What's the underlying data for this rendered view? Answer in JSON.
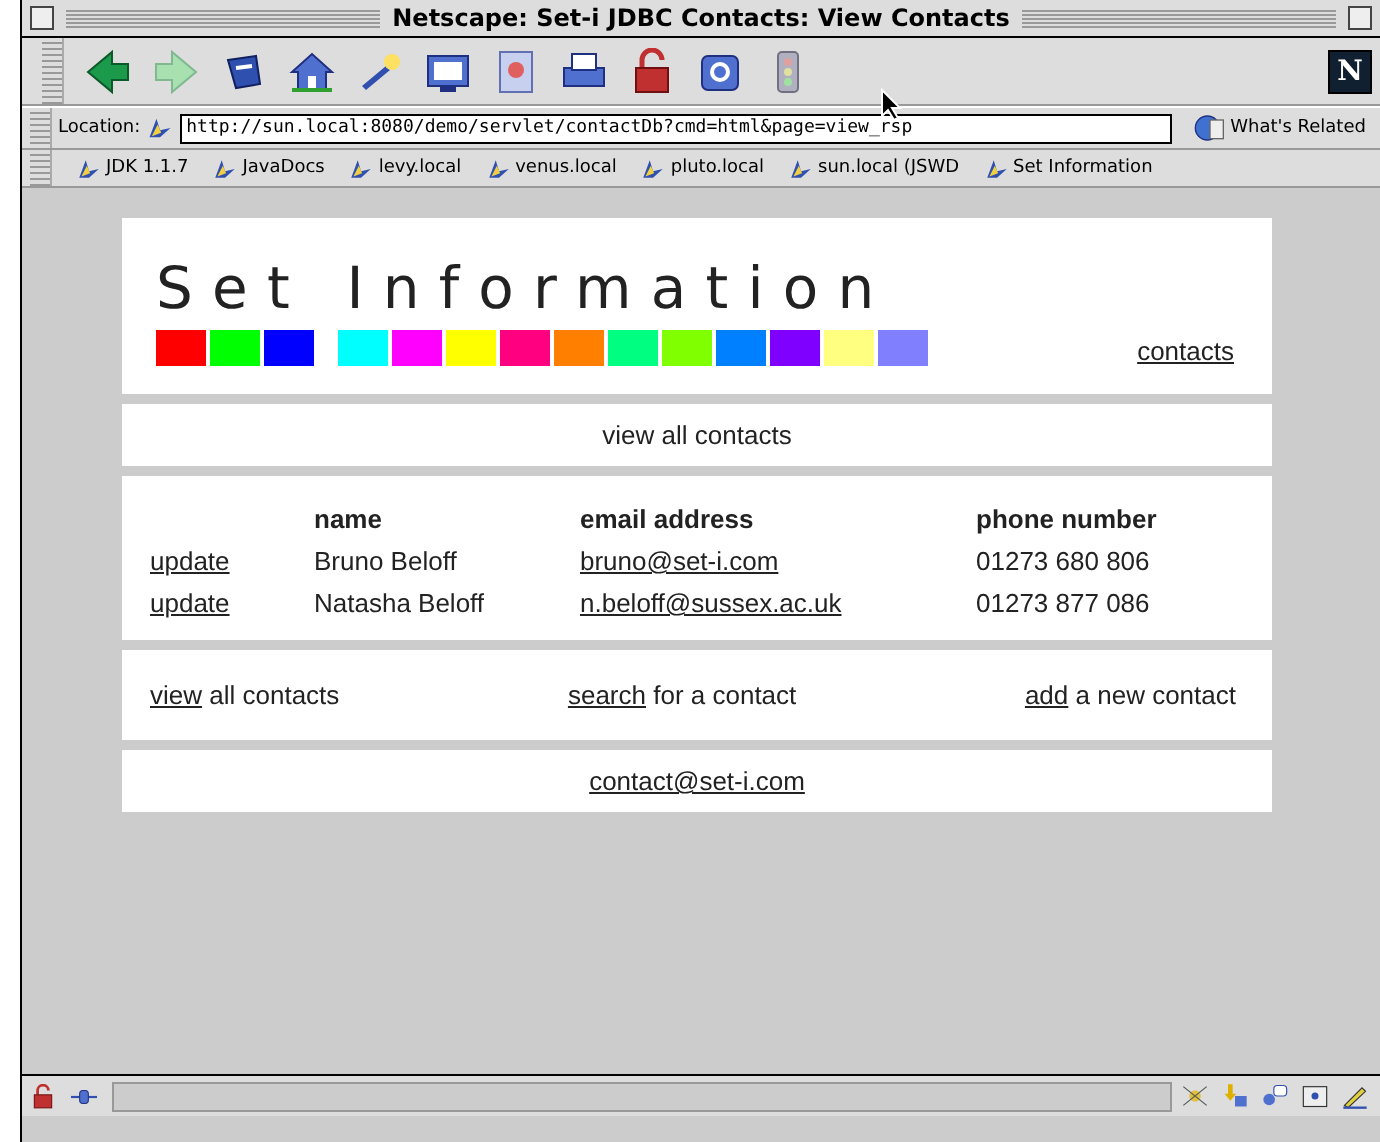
{
  "window": {
    "title": "Netscape: Set-i JDBC Contacts: View Contacts",
    "logo": "N"
  },
  "location": {
    "label": "Location:",
    "value": "http://sun.local:8080/demo/servlet/contactDb?cmd=html&page=view_rsp",
    "whats_related": "What's Related"
  },
  "bookmarks": [
    "JDK 1.1.7",
    "JavaDocs",
    "levy.local",
    "venus.local",
    "pluto.local",
    "sun.local (JSWD",
    "Set Information"
  ],
  "page": {
    "site_title": "Set Information",
    "color_blocks": [
      [
        {
          "color": "#ff0000"
        },
        {
          "color": "#00ff00"
        },
        {
          "color": "#0000ff"
        }
      ],
      [
        {
          "color": "#00ffff"
        },
        {
          "color": "#ff00ff"
        },
        {
          "color": "#ffff00"
        },
        {
          "color": "#ff0080"
        },
        {
          "color": "#ff8000"
        },
        {
          "color": "#00ff80"
        },
        {
          "color": "#80ff00"
        },
        {
          "color": "#0080ff"
        },
        {
          "color": "#8000ff"
        },
        {
          "color": "#ffff80"
        },
        {
          "color": "#8080ff"
        }
      ]
    ],
    "header_link": "contacts",
    "nav_link": "view all contacts",
    "table": {
      "columns": [
        "name",
        "email address",
        "phone number"
      ],
      "rows": [
        {
          "action": "update",
          "name": "Bruno Beloff",
          "email": "bruno@set-i.com",
          "phone": "01273 680 806"
        },
        {
          "action": "update",
          "name": "Natasha Beloff",
          "email": "n.beloff@sussex.ac.uk",
          "phone": "01273 877 086"
        }
      ]
    },
    "actions": [
      {
        "link": "view",
        "text": "all contacts"
      },
      {
        "link": "search",
        "text": "for a contact"
      },
      {
        "link": "add",
        "text": "a new contact"
      }
    ],
    "footer_email": "contact@set-i.com"
  }
}
